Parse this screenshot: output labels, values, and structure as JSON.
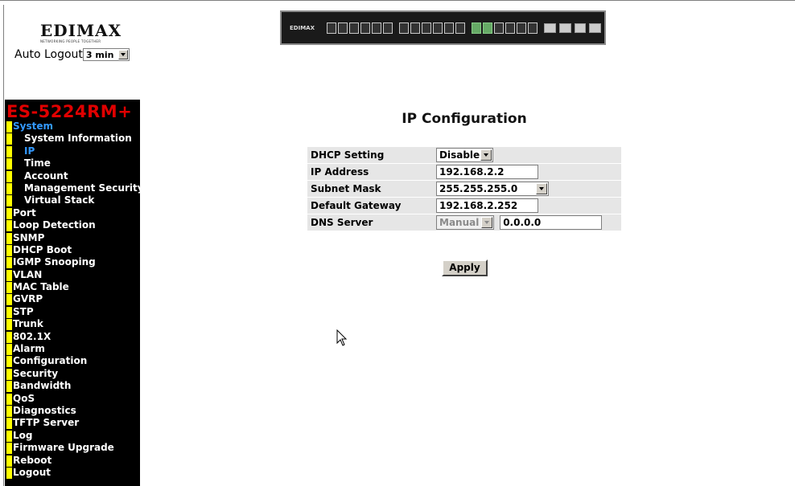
{
  "header": {
    "logo_brand": "EDIMAX",
    "logo_tagline": "NETWORKING PEOPLE TOGETHER",
    "auto_logout_label": "Auto Logout",
    "auto_logout_value": "3 min",
    "switch_brand": "EDIMAX"
  },
  "sidebar": {
    "model": "ES-5224RM+",
    "items": [
      {
        "label": "System",
        "sub": false,
        "active": true
      },
      {
        "label": "System Information",
        "sub": true,
        "active": false
      },
      {
        "label": "IP",
        "sub": true,
        "active": true
      },
      {
        "label": "Time",
        "sub": true,
        "active": false
      },
      {
        "label": "Account",
        "sub": true,
        "active": false
      },
      {
        "label": "Management Security",
        "sub": true,
        "active": false
      },
      {
        "label": "Virtual Stack",
        "sub": true,
        "active": false
      },
      {
        "label": "Port",
        "sub": false,
        "active": false
      },
      {
        "label": "Loop Detection",
        "sub": false,
        "active": false
      },
      {
        "label": "SNMP",
        "sub": false,
        "active": false
      },
      {
        "label": "DHCP Boot",
        "sub": false,
        "active": false
      },
      {
        "label": "IGMP Snooping",
        "sub": false,
        "active": false
      },
      {
        "label": "VLAN",
        "sub": false,
        "active": false
      },
      {
        "label": "MAC Table",
        "sub": false,
        "active": false
      },
      {
        "label": "GVRP",
        "sub": false,
        "active": false
      },
      {
        "label": "STP",
        "sub": false,
        "active": false
      },
      {
        "label": "Trunk",
        "sub": false,
        "active": false
      },
      {
        "label": "802.1X",
        "sub": false,
        "active": false
      },
      {
        "label": "Alarm",
        "sub": false,
        "active": false
      },
      {
        "label": "Configuration",
        "sub": false,
        "active": false
      },
      {
        "label": "Security",
        "sub": false,
        "active": false
      },
      {
        "label": "Bandwidth",
        "sub": false,
        "active": false
      },
      {
        "label": "QoS",
        "sub": false,
        "active": false
      },
      {
        "label": "Diagnostics",
        "sub": false,
        "active": false
      },
      {
        "label": "TFTP Server",
        "sub": false,
        "active": false
      },
      {
        "label": "Log",
        "sub": false,
        "active": false
      },
      {
        "label": "Firmware Upgrade",
        "sub": false,
        "active": false
      },
      {
        "label": "Reboot",
        "sub": false,
        "active": false
      },
      {
        "label": "Logout",
        "sub": false,
        "active": false
      }
    ]
  },
  "main": {
    "title": "IP Configuration",
    "dhcp_label": "DHCP Setting",
    "dhcp_value": "Disable",
    "ip_label": "IP Address",
    "ip_value": "192.168.2.2",
    "mask_label": "Subnet Mask",
    "mask_value": "255.255.255.0",
    "gateway_label": "Default Gateway",
    "gateway_value": "192.168.2.252",
    "dns_label": "DNS Server",
    "dns_mode": "Manual",
    "dns_value": "0.0.0.0",
    "apply_label": "Apply"
  },
  "colors": {
    "sidebar_bg": "#000000",
    "model_text": "#e00000",
    "bullet": "#ffff00",
    "active_item": "#3399ff",
    "row_bg": "#e6e6e6"
  }
}
